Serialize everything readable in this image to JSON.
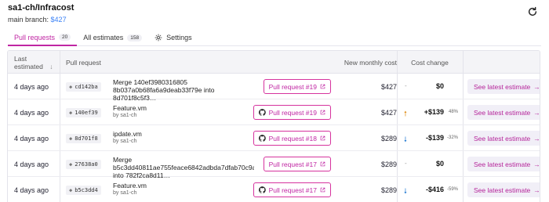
{
  "header": {
    "repo": "sa1-ch/Infracost",
    "branch_label": "main branch:",
    "branch_cost": "$427"
  },
  "tabs": [
    {
      "label": "Pull requests",
      "count": "20"
    },
    {
      "label": "All estimates",
      "count": "158"
    },
    {
      "label": "Settings"
    }
  ],
  "columns": {
    "last_estimated_line1": "Last",
    "last_estimated_line2": "estimated",
    "sort_indicator": "↓",
    "pull_request": "Pull request",
    "new_monthly_cost": "New monthly cost",
    "cost_change": "Cost change"
  },
  "rows": [
    {
      "date": "4 days ago",
      "sha": "cd142ba",
      "title": "Merge 140ef3980316805 8b037a0b68fa6a9deab33f79e into 8d701f8c5f3…",
      "by": "",
      "pr_label": "Pull request #19",
      "github_icon": false,
      "cost": "$427",
      "trend": "none",
      "dash": "-",
      "change": "$0",
      "pct": "",
      "action": "See latest estimate"
    },
    {
      "date": "4 days ago",
      "sha": "140ef39",
      "title": "Feature.vm",
      "by": "by sa1-ch",
      "pr_label": "Pull request #19",
      "github_icon": true,
      "cost": "$427",
      "trend": "up",
      "dash": "",
      "change": "+$139",
      "pct": "48%",
      "action": "See latest estimate"
    },
    {
      "date": "4 days ago",
      "sha": "8d701f8",
      "title": "ipdate.vm",
      "by": "by sa1-ch",
      "pr_label": "Pull request #18",
      "github_icon": true,
      "cost": "$289",
      "trend": "down",
      "dash": "",
      "change": "-$139",
      "pct": "-32%",
      "action": "See latest estimate"
    },
    {
      "date": "4 days ago",
      "sha": "27638a0",
      "title": "Merge b5c3dd40811ae755feace6842adbda7dfab70c9a into 782f2ca8d11…",
      "by": "",
      "pr_label": "Pull request #17",
      "github_icon": false,
      "cost": "$289",
      "trend": "none",
      "dash": "-",
      "change": "$0",
      "pct": "",
      "action": "See latest estimate"
    },
    {
      "date": "4 days ago",
      "sha": "b5c3dd4",
      "title": "Feature.vm",
      "by": "by sa1-ch",
      "pr_label": "Pull request #17",
      "github_icon": true,
      "cost": "$289",
      "trend": "down",
      "dash": "",
      "change": "-$416",
      "pct": "-59%",
      "action": "See latest estimate"
    }
  ],
  "icons": {
    "refresh": "refresh-icon",
    "settings": "gear-icon",
    "github": "github-icon",
    "external_link": "external-link-icon",
    "arrow_right": "arrow-right-icon",
    "commit": "commit-icon",
    "trend_up": "arrow-up-icon",
    "trend_down": "arrow-down-icon"
  },
  "colors": {
    "accent": "#c026a3",
    "branch_cost": "#3b82f6",
    "trend_up": "#e0911f",
    "trend_down": "#2a7fd4"
  }
}
